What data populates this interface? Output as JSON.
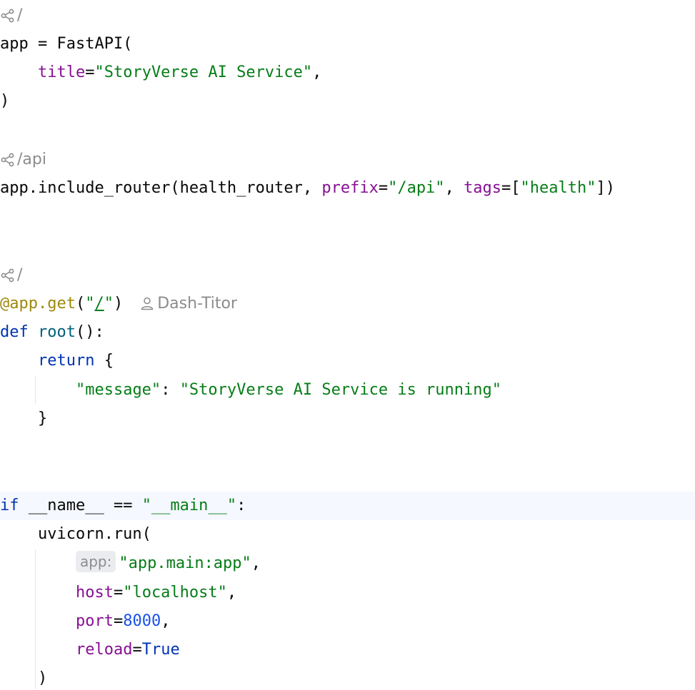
{
  "route_hints": {
    "root_app": "/",
    "health": "/api",
    "root_endpoint": "/"
  },
  "author_hint": "Dash-Titor",
  "param_hint_app": "app:",
  "code": {
    "l1_a": "app = FastAPI(",
    "l2_indent": "    ",
    "l2_kw": "title",
    "l2_eq": "=",
    "l2_str": "\"StoryVerse AI Service\"",
    "l2_end": ",",
    "l3": ")",
    "l5_a": "app.include_router(health_router, ",
    "l5_kw1": "prefix",
    "l5_eq1": "=",
    "l5_str1": "\"/api\"",
    "l5_sep": ", ",
    "l5_kw2": "tags",
    "l5_eq2": "=[",
    "l5_str2": "\"health\"",
    "l5_end": "])",
    "l8_dec": "@app.get",
    "l8_paren_open": "(",
    "l8_q1": "\"",
    "l8_slash": "/",
    "l8_q2": "\"",
    "l8_paren_close": ")",
    "l9_kw": "def",
    "l9_sp": " ",
    "l9_fn": "root",
    "l9_end": "():",
    "l10_indent": "    ",
    "l10_kw": "return",
    "l10_end": " {",
    "l11_indent": "        ",
    "l11_key": "\"message\"",
    "l11_colon": ": ",
    "l11_val": "\"StoryVerse AI Service is running\"",
    "l12": "    }",
    "l15_kw": "if",
    "l15_mid": " __name__ == ",
    "l15_str": "\"__main__\"",
    "l15_end": ":",
    "l16": "    uvicorn.run(",
    "l17_indent": "        ",
    "l17_str": "\"app.main:app\"",
    "l17_end": ",",
    "l18_indent": "        ",
    "l18_kw": "host",
    "l18_eq": "=",
    "l18_str": "\"localhost\"",
    "l18_end": ",",
    "l19_indent": "        ",
    "l19_kw": "port",
    "l19_eq": "=",
    "l19_num": "8000",
    "l19_end": ",",
    "l20_indent": "        ",
    "l20_kw": "reload",
    "l20_eq": "=",
    "l20_val": "True",
    "l21": "    )"
  },
  "colors": {
    "keyword": "#0033b3",
    "string": "#067d17",
    "named_argument": "#871094",
    "decorator": "#9e880d",
    "number": "#1750eb",
    "function_name": "#00627a",
    "hint_text": "#8c8c8c",
    "current_line": "#f5f8fe"
  },
  "icons": {
    "route": "route-share-icon",
    "author": "person-icon"
  }
}
